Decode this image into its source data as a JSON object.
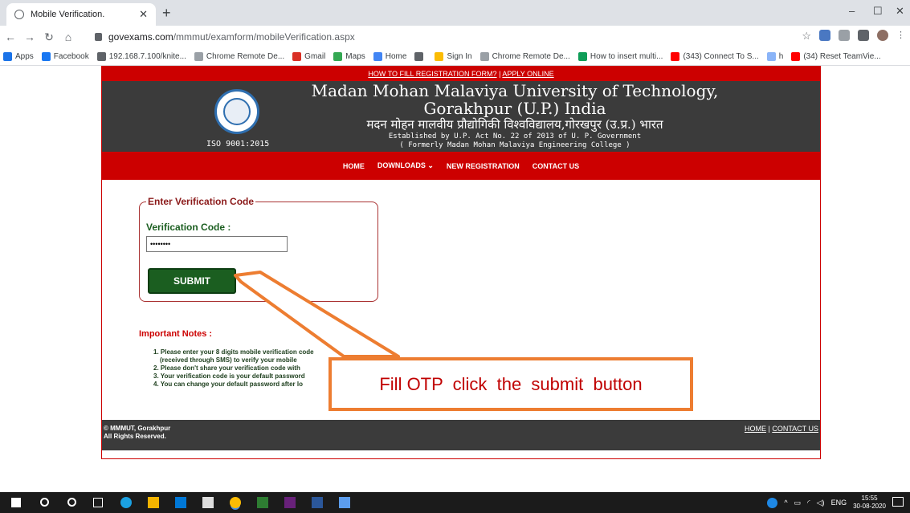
{
  "browser": {
    "tab_title": "Mobile Verification.",
    "url_host": "govexams.com",
    "url_path": "/mmmut/examform/mobileVerification.aspx",
    "bookmarks": [
      {
        "label": "Apps",
        "color": "#1a73e8"
      },
      {
        "label": "Facebook",
        "color": "#1877f2"
      },
      {
        "label": "192.168.7.100/knite...",
        "color": "#5f6368"
      },
      {
        "label": "Chrome Remote De...",
        "color": "#9aa0a6"
      },
      {
        "label": "Gmail",
        "color": "#d93025"
      },
      {
        "label": "Maps",
        "color": "#34a853"
      },
      {
        "label": "Home",
        "color": "#4285f4"
      },
      {
        "label": "",
        "color": "#5f6368"
      },
      {
        "label": "Sign In",
        "color": "#fbbc04"
      },
      {
        "label": "Chrome Remote De...",
        "color": "#9aa0a6"
      },
      {
        "label": "How to insert multi...",
        "color": "#0f9d58"
      },
      {
        "label": "(343) Connect To S...",
        "color": "#ff0000"
      },
      {
        "label": "h",
        "color": "#8ab4f8"
      },
      {
        "label": "(34) Reset TeamVie...",
        "color": "#ff0000"
      }
    ]
  },
  "site": {
    "top_link_1": "HOW TO FILL REGISTRATION FORM?",
    "top_link_sep": "|",
    "top_link_2": "APPLY ONLINE",
    "name_line_1": "Madan Mohan Malaviya University of Technology,",
    "name_line_2": "Gorakhpur (U.P.) India",
    "hindi": "मदन मोहन मालवीय प्रौद्योगिकी विश्वविद्यालय,गोरखपुर (उ.प्र.) भारत",
    "est_line_1": "Established by U.P. Act No. 22 of 2013 of U. P. Government",
    "est_line_2": "( Formerly Madan Mohan Malaviya Engineering College )",
    "iso": "ISO 9001:2015",
    "menu": [
      "HOME",
      "DOWNLOADS ⌄",
      "NEW REGISTRATION",
      "CONTACT US"
    ]
  },
  "form": {
    "legend": "Enter Verification Code",
    "label": "Verification Code :",
    "value": "••••••••",
    "submit": "SUBMIT"
  },
  "notes": {
    "title": "Important Notes :",
    "items": [
      "1. Please enter your 8 digits mobile verification code",
      "(received through SMS) to verify your mobile",
      "2. Please don't share your verification code with",
      "3. Your verification code is your default password",
      "4. You can change your default password after lo"
    ]
  },
  "footer": {
    "line_1": "© MMMUT, Gorakhpur",
    "line_2": "All Rights Reserved.",
    "link_home": "HOME",
    "link_sep": "|",
    "link_contact": "CONTACT US"
  },
  "callout": {
    "text": "Fill OTP  click  the  submit  button"
  },
  "taskbar": {
    "lang": "ENG",
    "time": "15:55",
    "date": "30-08-2020"
  }
}
